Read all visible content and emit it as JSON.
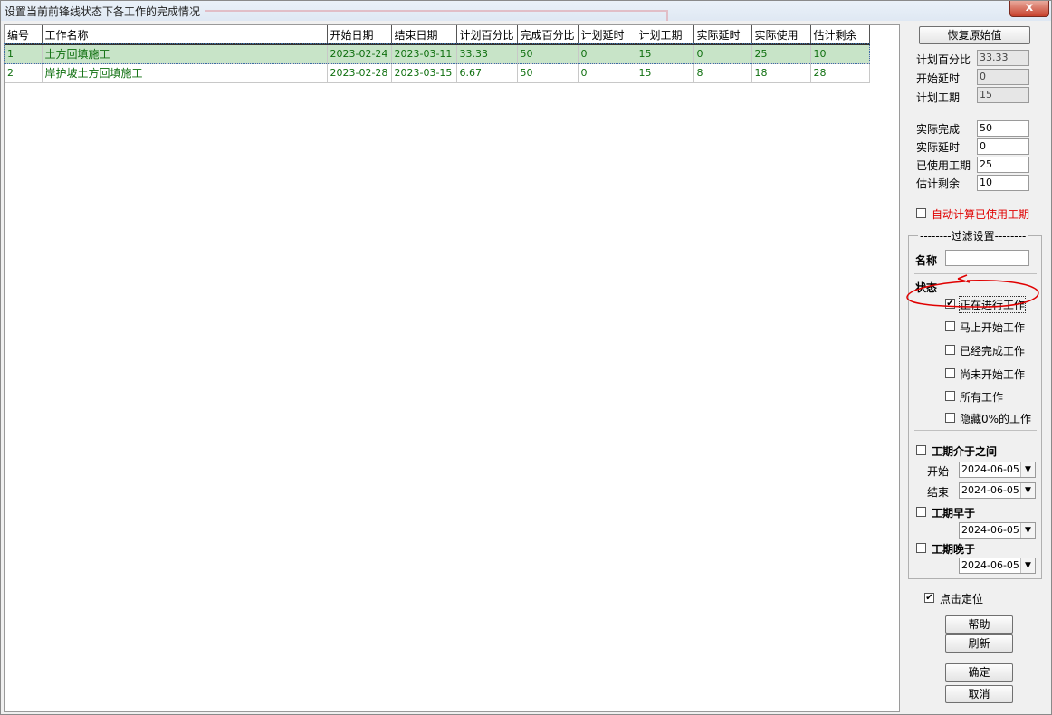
{
  "window": {
    "title": "设置当前前锋线状态下各工作的完成情况",
    "close_label": "x"
  },
  "table": {
    "columns": [
      "编号",
      "工作名称",
      "开始日期",
      "结束日期",
      "计划百分比",
      "完成百分比",
      "计划延时",
      "计划工期",
      "实际延时",
      "实际使用",
      "估计剩余"
    ],
    "rows": [
      [
        "1",
        "土方回填施工",
        "2023-02-24",
        "2023-03-11",
        "33.33",
        "50",
        "0",
        "15",
        "0",
        "25",
        "10"
      ],
      [
        "2",
        "岸护坡土方回填施工",
        "2023-02-28",
        "2023-03-15",
        "6.67",
        "50",
        "0",
        "15",
        "8",
        "18",
        "28"
      ]
    ]
  },
  "panel": {
    "restore_label": "恢复原始值",
    "plan_pct_label": "计划百分比",
    "plan_pct_value": "33.33",
    "start_delay_label": "开始延时",
    "start_delay_value": "0",
    "plan_duration_label": "计划工期",
    "plan_duration_value": "15",
    "actual_done_label": "实际完成",
    "actual_done_value": "50",
    "actual_delay_label": "实际延时",
    "actual_delay_value": "0",
    "used_duration_label": "已使用工期",
    "used_duration_value": "25",
    "remaining_label": "估计剩余",
    "remaining_value": "10",
    "auto_calc_label": "自动计算已使用工期",
    "filter_title": "--------过滤设置--------",
    "name_label": "名称",
    "name_value": "",
    "status_label": "状态",
    "status_options": [
      "正在进行工作",
      "马上开始工作",
      "已经完成工作",
      "尚未开始工作",
      "所有工作"
    ],
    "status_checked": [
      true,
      false,
      false,
      false,
      false
    ],
    "hide_zero_label": "隐藏0%的工作",
    "duration_between_label": "工期介于之间",
    "start_label": "开始",
    "end_label": "结束",
    "earlier_label": "工期早于",
    "later_label": "工期晚于",
    "date_value": "2024-06-05",
    "click_locate_label": "点击定位",
    "help_label": "帮助",
    "refresh_label": "刷新",
    "ok_label": "确定",
    "cancel_label": "取消"
  },
  "colors": {
    "row_text": "#107010",
    "selected_row_bg": "#c8e4c8",
    "annotation": "#e00000"
  }
}
